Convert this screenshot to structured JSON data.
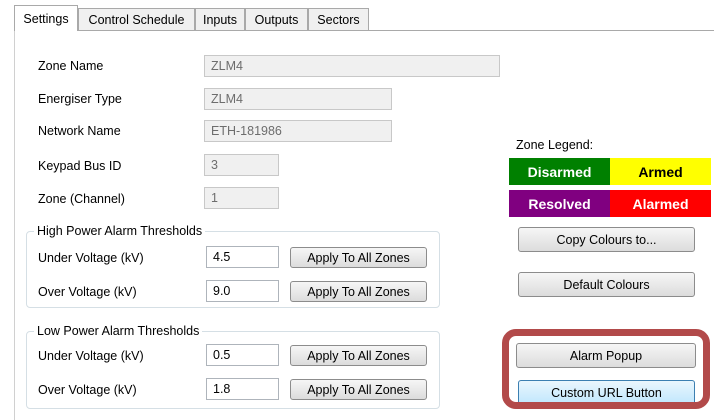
{
  "tabs": [
    {
      "label": "Settings",
      "active": true
    },
    {
      "label": "Control Schedule",
      "active": false
    },
    {
      "label": "Inputs",
      "active": false
    },
    {
      "label": "Outputs",
      "active": false
    },
    {
      "label": "Sectors",
      "active": false
    }
  ],
  "fields": {
    "zone_name": {
      "label": "Zone Name",
      "value": "ZLM4"
    },
    "energiser_type": {
      "label": "Energiser Type",
      "value": "ZLM4"
    },
    "network_name": {
      "label": "Network Name",
      "value": "ETH-181986"
    },
    "keypad_bus_id": {
      "label": "Keypad Bus ID",
      "value": "3"
    },
    "zone_channel": {
      "label": "Zone (Channel)",
      "value": "1"
    }
  },
  "high_power": {
    "title": "High Power Alarm Thresholds",
    "under": {
      "label": "Under Voltage (kV)",
      "value": "4.5"
    },
    "over": {
      "label": "Over Voltage (kV)",
      "value": "9.0"
    }
  },
  "low_power": {
    "title": "Low Power Alarm Thresholds",
    "under": {
      "label": "Under Voltage (kV)",
      "value": "0.5"
    },
    "over": {
      "label": "Over Voltage (kV)",
      "value": "1.8"
    }
  },
  "apply_label": "Apply To All Zones",
  "legend": {
    "title": "Zone Legend:",
    "items": [
      {
        "label": "Disarmed",
        "bg": "#008000",
        "fg": "#ffffff"
      },
      {
        "label": "Armed",
        "bg": "#ffff00",
        "fg": "#000000"
      },
      {
        "label": "Resolved",
        "bg": "#800080",
        "fg": "#ffffff"
      },
      {
        "label": "Alarmed",
        "bg": "#ff0000",
        "fg": "#ffffff"
      }
    ]
  },
  "buttons": {
    "copy_colours": "Copy Colours to...",
    "default_colours": "Default Colours",
    "alarm_popup": "Alarm Popup",
    "custom_url": "Custom URL Button"
  },
  "highlight_color": "#b24a4a"
}
